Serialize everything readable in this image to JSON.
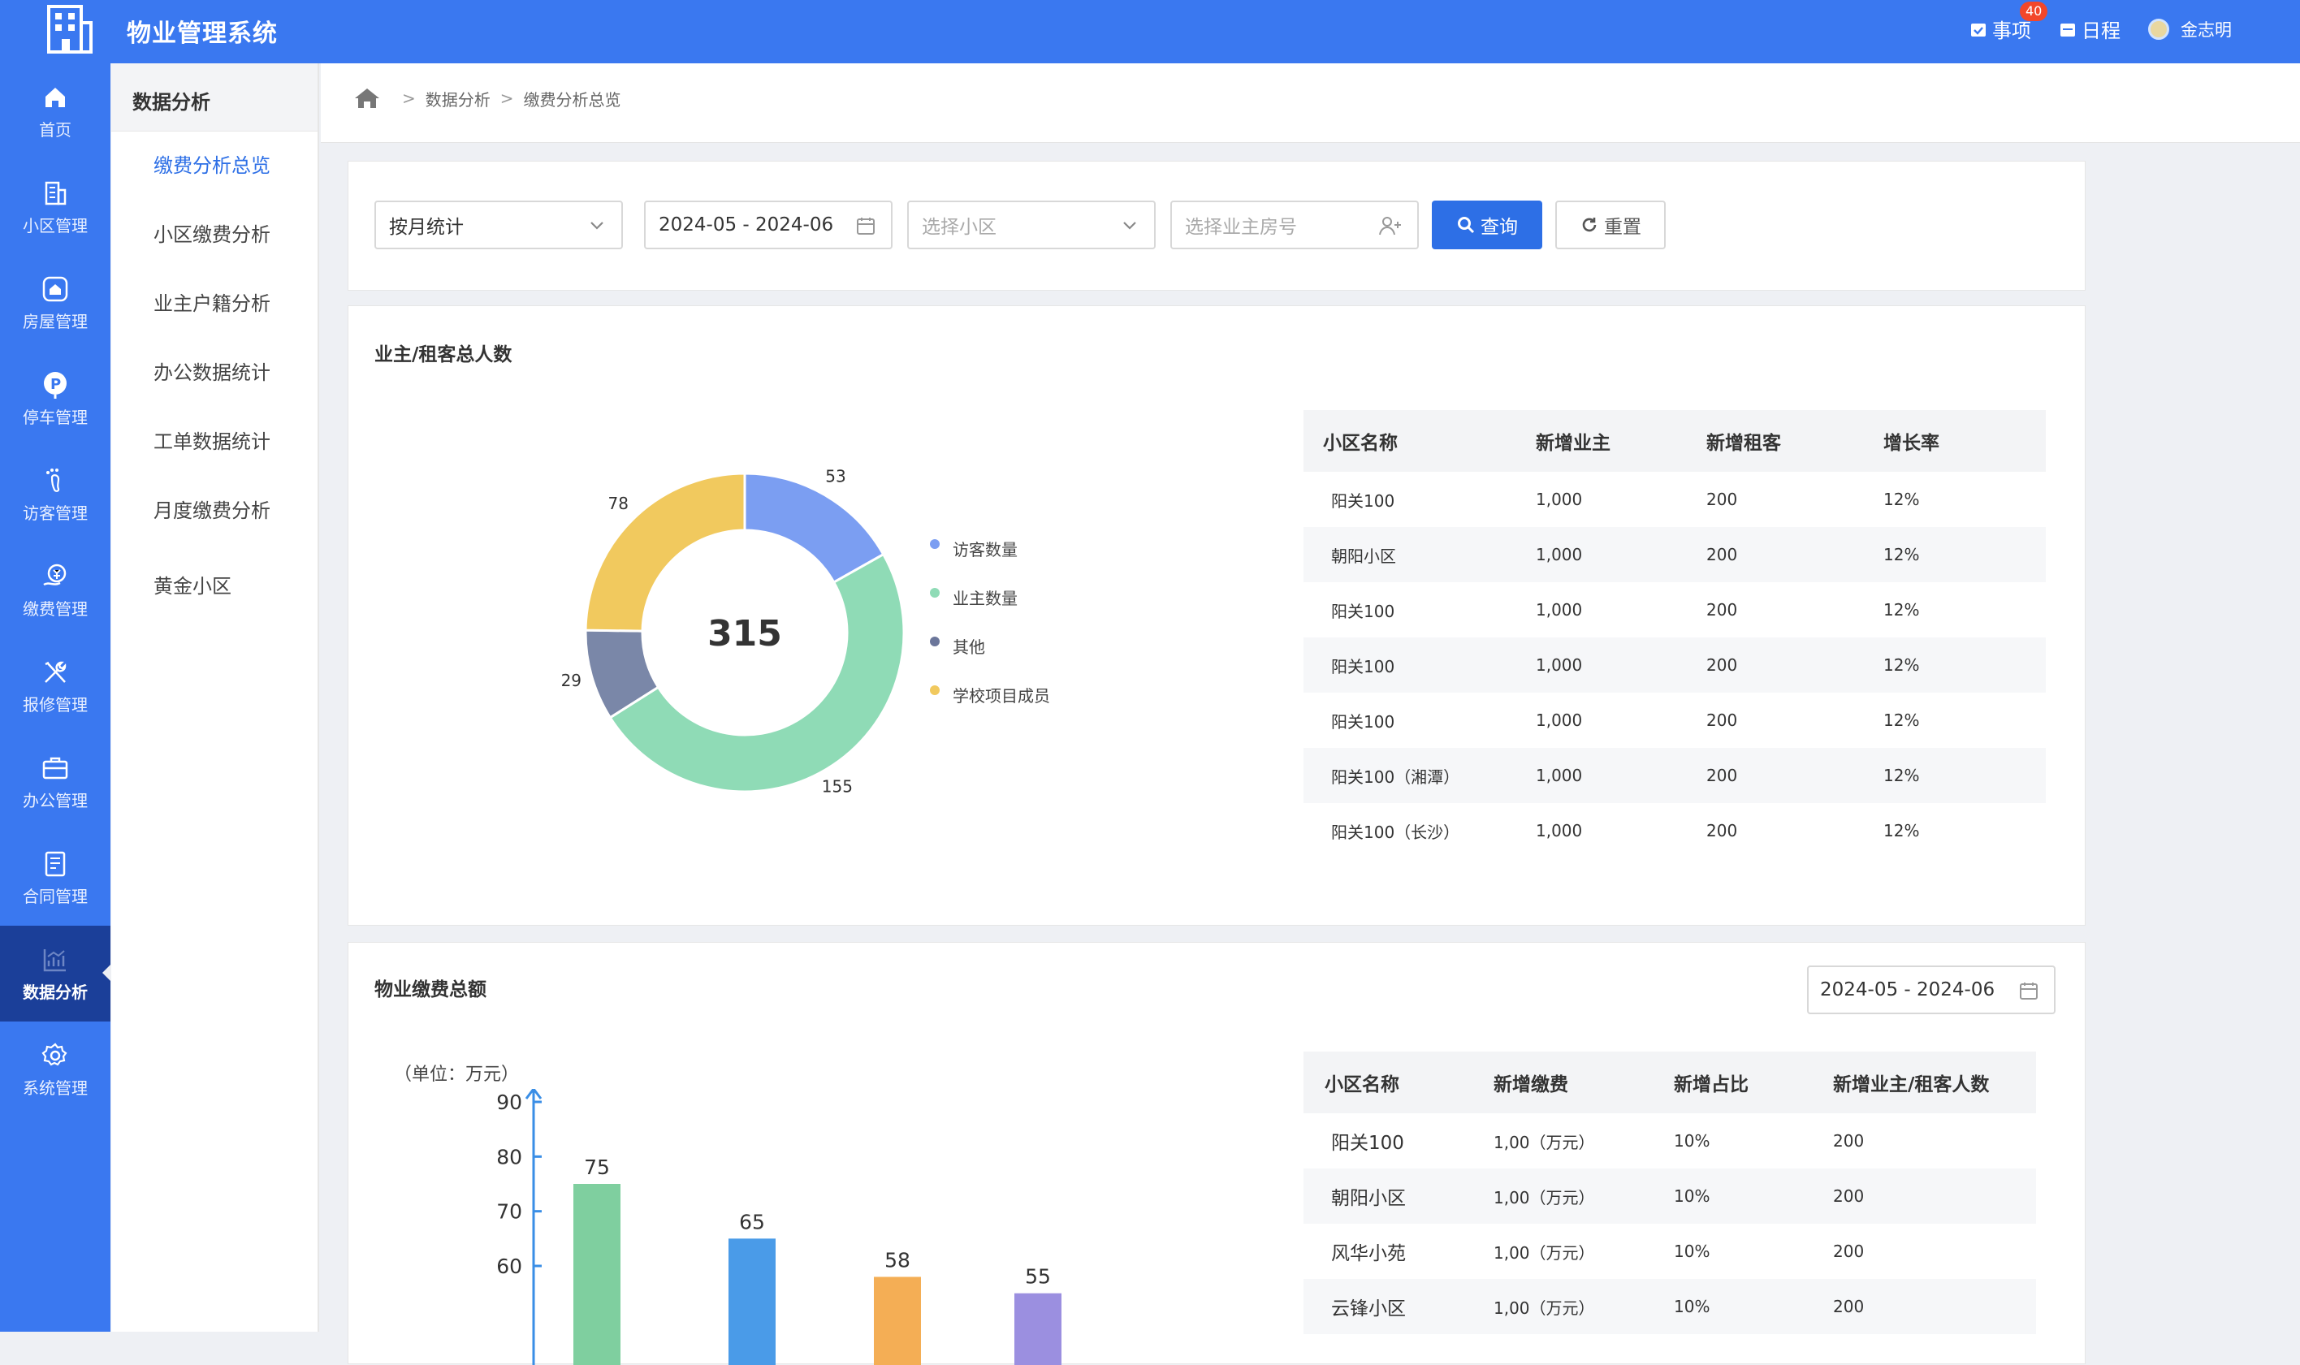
{
  "app": {
    "title": "物业管理系统"
  },
  "topbar": {
    "todo_label": "事项",
    "todo_count": "40",
    "schedule_label": "日程",
    "user_name": "金志明"
  },
  "sidebar": {
    "items": [
      {
        "label": "首页",
        "icon": "home-icon"
      },
      {
        "label": "小区管理",
        "icon": "building-icon"
      },
      {
        "label": "房屋管理",
        "icon": "house-icon"
      },
      {
        "label": "停车管理",
        "icon": "parking-icon"
      },
      {
        "label": "访客管理",
        "icon": "footprint-icon"
      },
      {
        "label": "缴费管理",
        "icon": "payment-icon"
      },
      {
        "label": "报修管理",
        "icon": "tools-icon"
      },
      {
        "label": "办公管理",
        "icon": "briefcase-icon"
      },
      {
        "label": "合同管理",
        "icon": "contract-icon"
      },
      {
        "label": "数据分析",
        "icon": "chart-icon",
        "active": true
      },
      {
        "label": "系统管理",
        "icon": "gear-icon"
      }
    ]
  },
  "subnav": {
    "title": "数据分析",
    "items": [
      "缴费分析总览",
      "小区缴费分析",
      "业主户籍分析",
      "办公数据统计",
      "工单数据统计",
      "月度缴费分析",
      "黄金小区"
    ]
  },
  "breadcrumb": {
    "level1": "数据分析",
    "level2": "缴费分析总览"
  },
  "filter": {
    "period": "按月统计",
    "date_range": "2024-05 - 2024-06",
    "community_placeholder": "选择小区",
    "owner_placeholder": "选择业主房号",
    "query_label": "查询",
    "reset_label": "重置"
  },
  "residents": {
    "title": "业主/租客总人数",
    "total": "315",
    "slice_labels": {
      "visitors": "53",
      "owners": "155",
      "others": "29",
      "school": "78"
    },
    "legend": [
      "访客数量",
      "业主数量",
      "其他",
      "学校项目成员"
    ],
    "table": {
      "headers": [
        "小区名称",
        "新增业主",
        "新增租客",
        "增长率"
      ],
      "rows": [
        [
          "阳关100",
          "1,000",
          "200",
          "12%"
        ],
        [
          "朝阳小区",
          "1,000",
          "200",
          "12%"
        ],
        [
          "阳关100",
          "1,000",
          "200",
          "12%"
        ],
        [
          "阳关100",
          "1,000",
          "200",
          "12%"
        ],
        [
          "阳关100",
          "1,000",
          "200",
          "12%"
        ],
        [
          "阳关100（湘潭）",
          "1,000",
          "200",
          "12%"
        ],
        [
          "阳关100（长沙）",
          "1,000",
          "200",
          "12%"
        ]
      ]
    }
  },
  "fees": {
    "title": "物业缴费总额",
    "date_range": "2024-05 - 2024-06",
    "unit": "（单位：万元）",
    "table": {
      "headers": [
        "小区名称",
        "新增缴费",
        "新增占比",
        "新增业主/租客人数"
      ],
      "rows": [
        [
          "阳关100",
          "1,00（万元）",
          "10%",
          "200"
        ],
        [
          "朝阳小区",
          "1,00（万元）",
          "10%",
          "200"
        ],
        [
          "风华小苑",
          "1,00（万元）",
          "10%",
          "200"
        ],
        [
          "云锋小区",
          "1,00（万元）",
          "10%",
          "200"
        ]
      ]
    }
  },
  "chart_data": [
    {
      "type": "pie",
      "title": "业主/租客总人数",
      "center_label": "315",
      "labels": [
        "访客数量",
        "业主数量",
        "其他",
        "学校项目成员"
      ],
      "values": [
        53,
        155,
        29,
        78
      ],
      "colors": [
        "#7b9ef2",
        "#8fdbb6",
        "#7a87a8",
        "#f1c95e"
      ]
    },
    {
      "type": "bar",
      "title": "物业缴费总额",
      "ylabel": "（单位：万元）",
      "values": [
        75,
        65,
        58,
        55
      ],
      "colors": [
        "#7fcf9f",
        "#4a9be8",
        "#f4ae55",
        "#9b8fe0"
      ],
      "yticks": [
        60,
        70,
        80,
        90
      ]
    }
  ]
}
